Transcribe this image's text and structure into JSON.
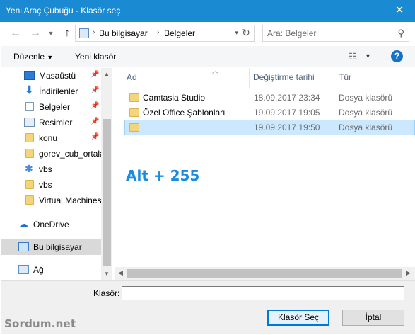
{
  "window": {
    "title": "Yeni Araç Çubuğu - Klasör seç",
    "close_glyph": "✕"
  },
  "navbar": {
    "back_icon": "back-arrow-icon",
    "forward_icon": "forward-arrow-icon",
    "recent_icon": "chevron-down-icon",
    "up_icon": "up-arrow-icon",
    "address": {
      "icon": "computer-icon",
      "segments": [
        "Bu bilgisayar",
        "Belgeler"
      ],
      "separator": "›"
    },
    "search_placeholder": "Ara: Belgeler"
  },
  "toolbar": {
    "organize_label": "Düzenle",
    "new_folder_label": "Yeni klasör",
    "help_label": "?"
  },
  "navpane": {
    "items": [
      {
        "label": "Masaüstü",
        "icon": "desktop-icon",
        "pinned": true
      },
      {
        "label": "İndirilenler",
        "icon": "download-icon",
        "pinned": true
      },
      {
        "label": "Belgeler",
        "icon": "documents-icon",
        "pinned": true
      },
      {
        "label": "Resimler",
        "icon": "pictures-icon",
        "pinned": true
      },
      {
        "label": "konu",
        "icon": "folder-icon",
        "pinned": true
      },
      {
        "label": "gorev_cub_ortala",
        "icon": "folder-icon",
        "pinned": false
      },
      {
        "label": "vbs",
        "icon": "vbs-icon",
        "pinned": false
      },
      {
        "label": "vbs",
        "icon": "folder-icon",
        "pinned": false
      },
      {
        "label": "Virtual Machines",
        "icon": "folder-icon",
        "pinned": false
      },
      {
        "label": "OneDrive",
        "icon": "onedrive-icon",
        "pinned": false
      },
      {
        "label": "Bu bilgisayar",
        "icon": "computer-icon",
        "pinned": false,
        "selected": true
      },
      {
        "label": "Ağ",
        "icon": "network-icon",
        "pinned": false
      }
    ]
  },
  "filelist": {
    "columns": [
      "Ad",
      "Değiştirme tarihi",
      "Tür"
    ],
    "rows": [
      {
        "name": "Camtasia Studio",
        "date": "18.09.2017 23:34",
        "type": "Dosya klasörü"
      },
      {
        "name": "Özel Office Şablonları",
        "date": "19.09.2017 19:05",
        "type": "Dosya klasörü"
      },
      {
        "name": "",
        "date": "19.09.2017 19:50",
        "type": "Dosya klasörü",
        "selected": true
      }
    ],
    "annotation": "Alt + 255"
  },
  "bottom": {
    "folder_label": "Klasör:",
    "folder_value": "",
    "select_button": "Klasör Seç",
    "cancel_button": "İptal"
  },
  "watermark": "Sordum.net",
  "colors": {
    "titlebar": "#1a8ad2",
    "selection": "#cce8ff",
    "annotation": "#1b8be0",
    "help": "#1672c4"
  }
}
